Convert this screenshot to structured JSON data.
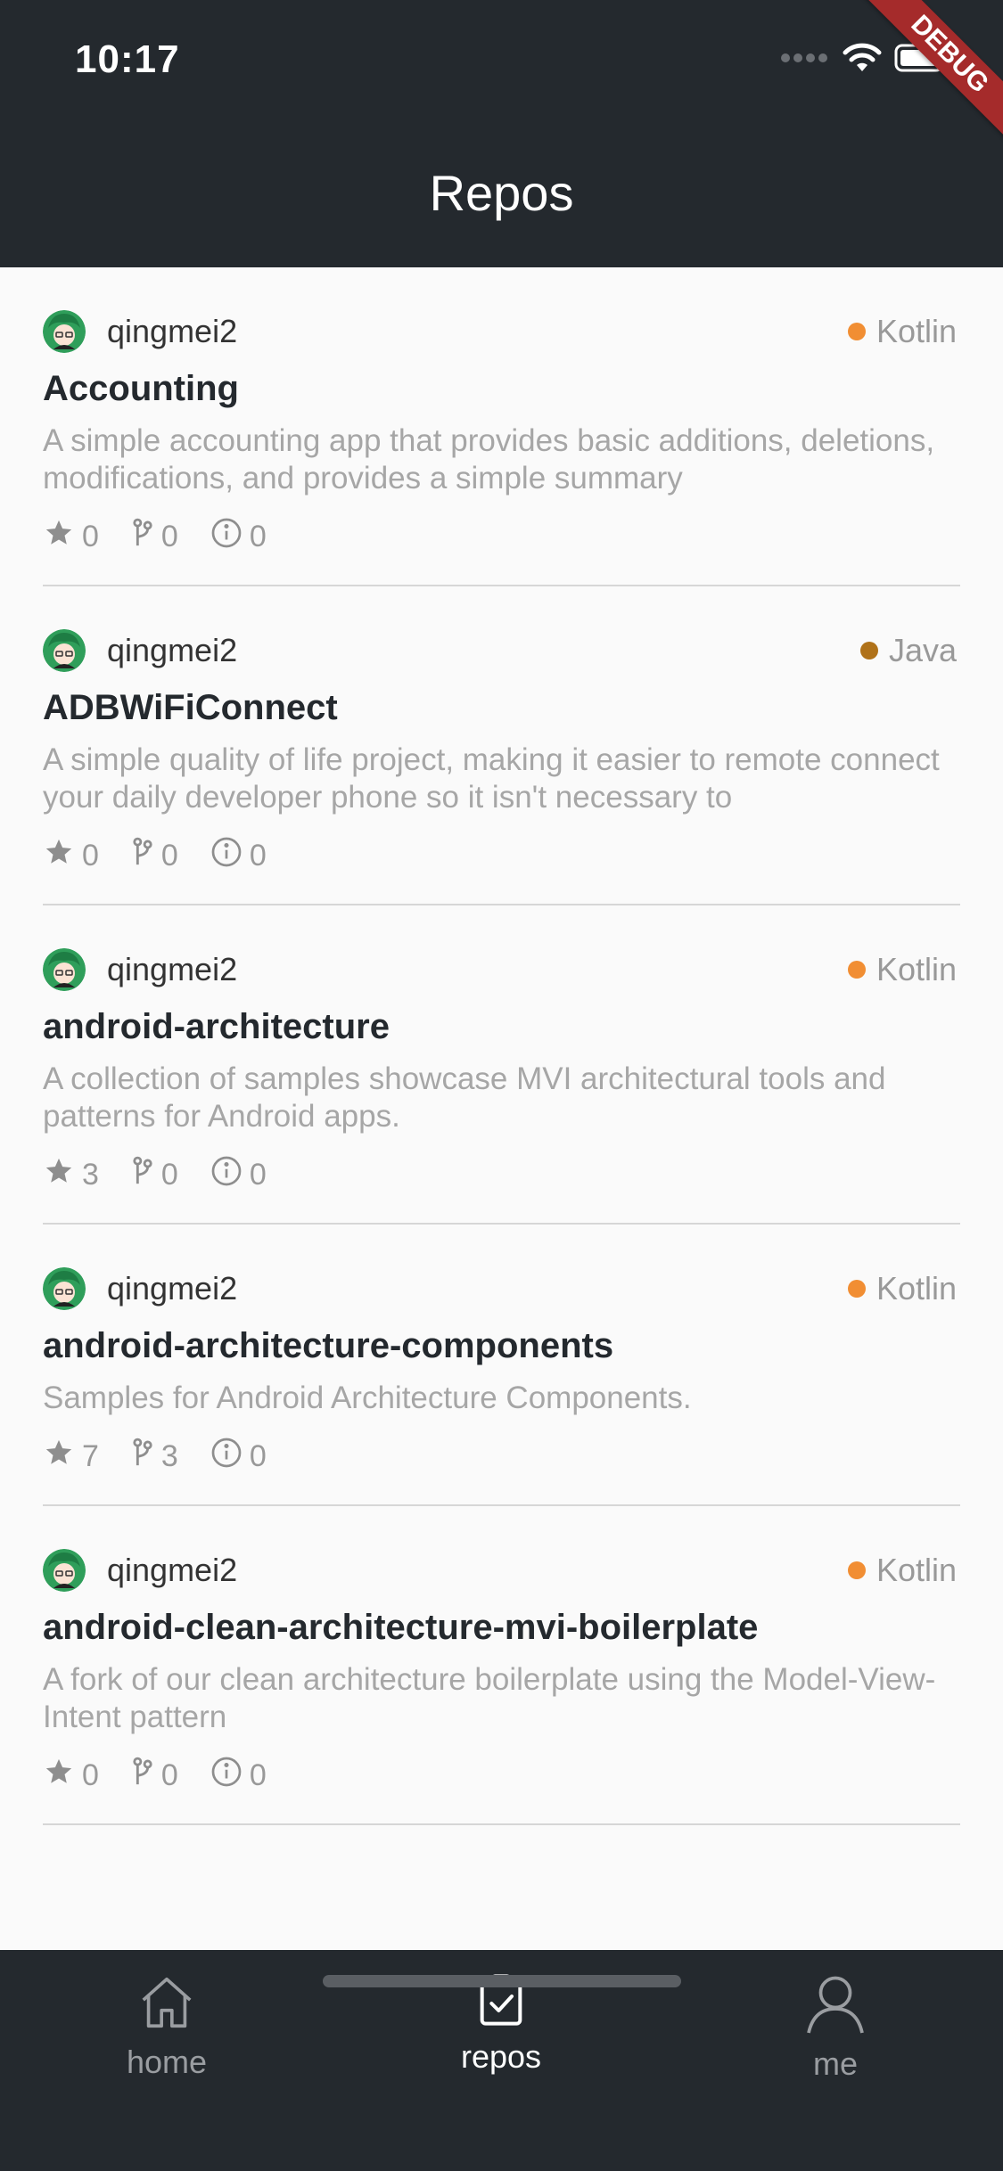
{
  "status_bar": {
    "time": "10:17"
  },
  "debug_banner": "DEBUG",
  "header": {
    "title": "Repos"
  },
  "lang_colors": {
    "Kotlin": "#f18e33",
    "Java": "#b07219"
  },
  "repos": [
    {
      "owner": "qingmei2",
      "language": "Kotlin",
      "name": "Accounting",
      "description": "A simple accounting app that provides basic additions, deletions, modifications, and provides a simple summary",
      "stars": "0",
      "forks": "0",
      "issues": "0"
    },
    {
      "owner": "qingmei2",
      "language": "Java",
      "name": "ADBWiFiConnect",
      "description": "A simple quality of life project, making it easier to remote connect your daily developer phone so it isn't necessary to",
      "stars": "0",
      "forks": "0",
      "issues": "0"
    },
    {
      "owner": "qingmei2",
      "language": "Kotlin",
      "name": "android-architecture",
      "description": "A collection of samples showcase MVI architectural tools and patterns for Android apps.",
      "stars": "3",
      "forks": "0",
      "issues": "0"
    },
    {
      "owner": "qingmei2",
      "language": "Kotlin",
      "name": "android-architecture-components",
      "description": "Samples for Android Architecture Components.",
      "stars": "7",
      "forks": "3",
      "issues": "0"
    },
    {
      "owner": "qingmei2",
      "language": "Kotlin",
      "name": "android-clean-architecture-mvi-boilerplate",
      "description": "A fork of our clean architecture boilerplate using the Model-View-Intent pattern",
      "stars": "0",
      "forks": "0",
      "issues": "0"
    }
  ],
  "bottom_nav": {
    "items": [
      {
        "label": "home",
        "icon": "home-icon",
        "active": false
      },
      {
        "label": "repos",
        "icon": "repos-clipboard-icon",
        "active": true
      },
      {
        "label": "me",
        "icon": "person-icon",
        "active": false
      }
    ]
  }
}
